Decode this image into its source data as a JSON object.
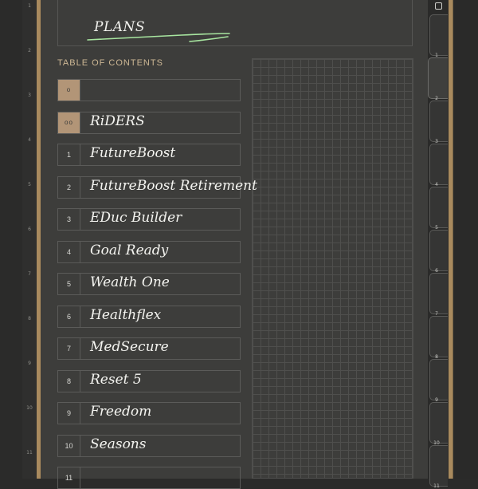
{
  "page": {
    "title": "PLANS",
    "toc_heading": "TABLE OF CONTENTS"
  },
  "margin_line_numbers": [
    "1",
    "2",
    "3",
    "4",
    "5",
    "6",
    "7",
    "8",
    "9",
    "10",
    "11"
  ],
  "toc_rows": [
    {
      "number": "o",
      "label": "",
      "marker": true
    },
    {
      "number": "oo",
      "label": "RiDERS",
      "marker": true
    },
    {
      "number": "1",
      "label": "FutureBoost"
    },
    {
      "number": "2",
      "label": "FutureBoost Retirement"
    },
    {
      "number": "3",
      "label": "EDuc Builder"
    },
    {
      "number": "4",
      "label": "Goal Ready"
    },
    {
      "number": "5",
      "label": "Wealth One"
    },
    {
      "number": "6",
      "label": "Healthflex"
    },
    {
      "number": "7",
      "label": "MedSecure"
    },
    {
      "number": "8",
      "label": "Reset 5"
    },
    {
      "number": "9",
      "label": "Freedom"
    },
    {
      "number": "10",
      "label": "Seasons"
    },
    {
      "number": "11",
      "label": ""
    }
  ],
  "side_tabs": [
    {
      "label": "1"
    },
    {
      "label": "2",
      "active": true
    },
    {
      "label": "3"
    },
    {
      "label": "4"
    },
    {
      "label": "5"
    },
    {
      "label": "6"
    },
    {
      "label": "7"
    },
    {
      "label": "8"
    },
    {
      "label": "9"
    },
    {
      "label": "10"
    },
    {
      "label": "11"
    }
  ],
  "icons": {
    "corner": "square-outline-icon"
  },
  "colors": {
    "background": "#2b2b2a",
    "sheet": "#3d3d3b",
    "accent_gold": "#a98a5e",
    "marker_fill": "#b29577",
    "heading_text": "#cdb794",
    "title_underline": "#a8e6a0"
  }
}
